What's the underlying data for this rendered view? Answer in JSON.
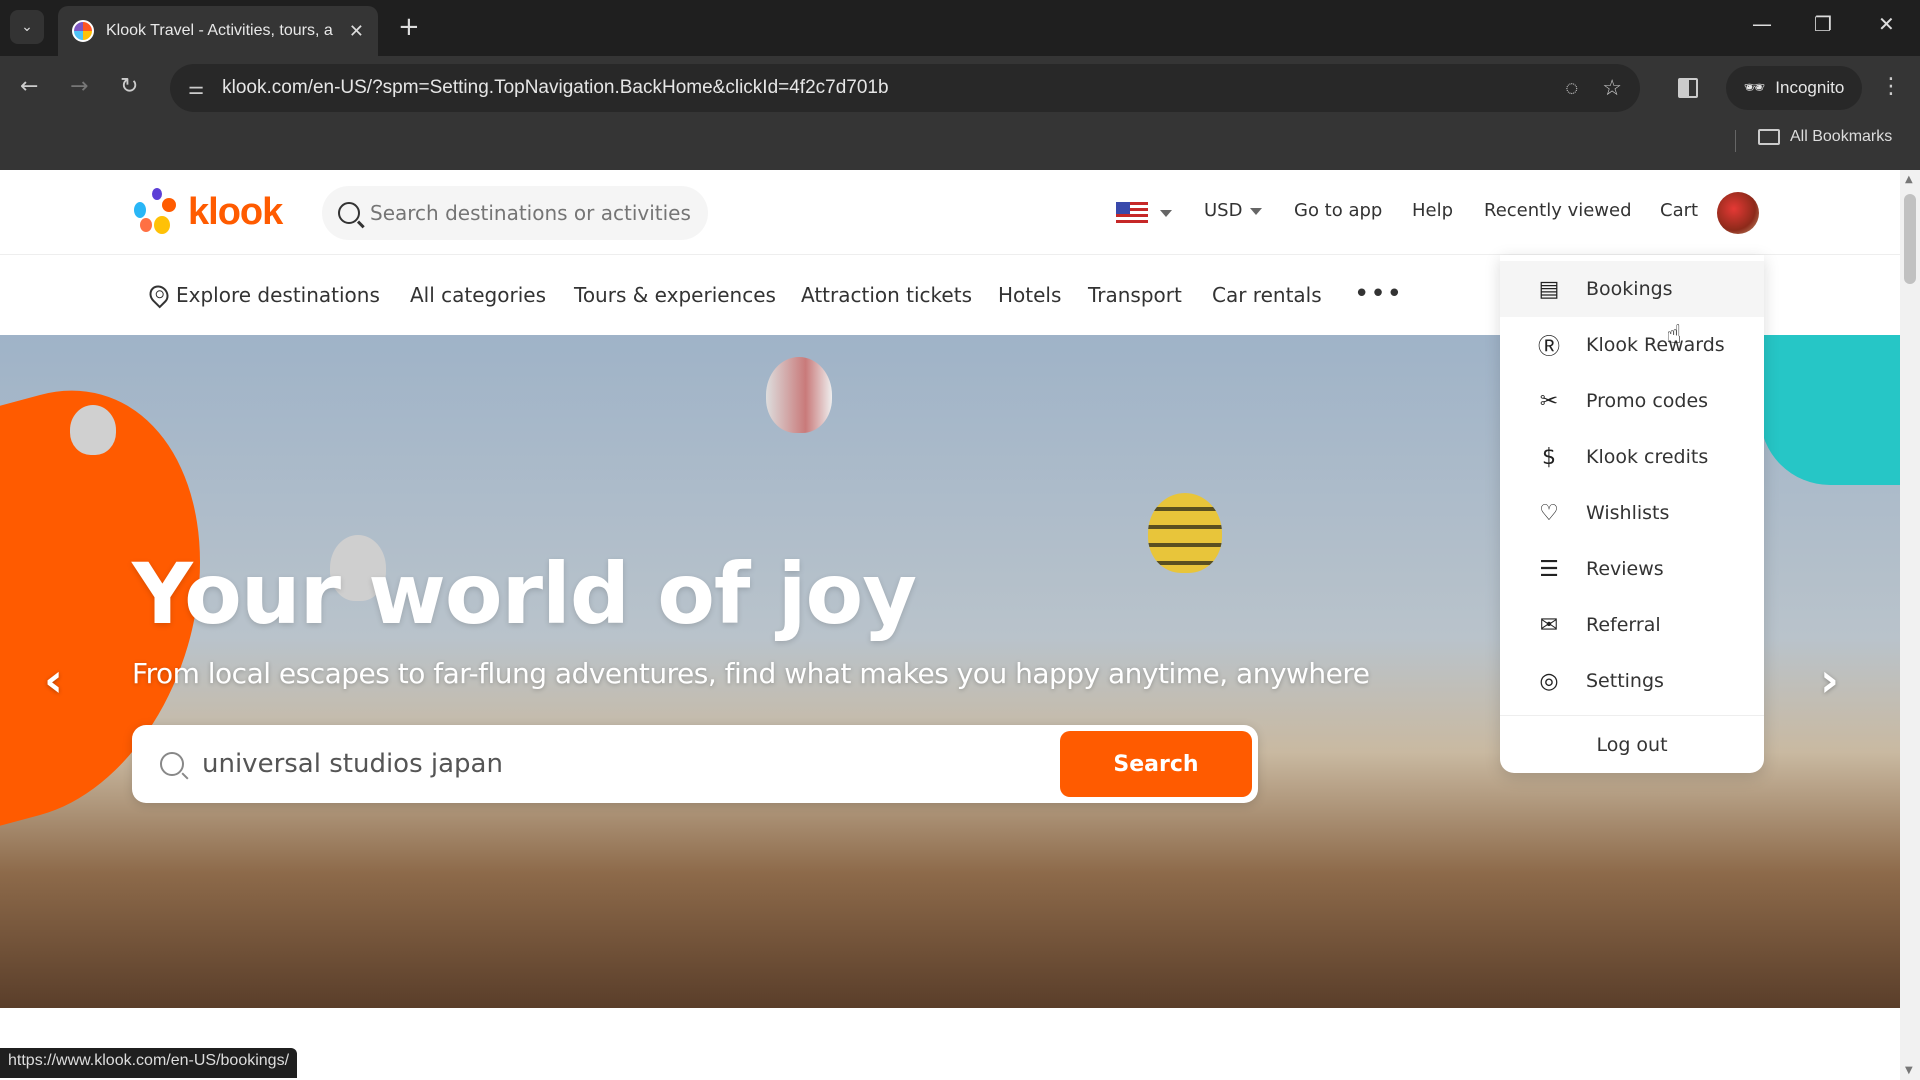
{
  "browser": {
    "tab_title": "Klook Travel - Activities, tours, a",
    "url": "klook.com/en-US/?spm=Setting.TopNavigation.BackHome&clickId=4f2c7d701b",
    "incognito_label": "Incognito",
    "all_bookmarks_label": "All Bookmarks",
    "status_url": "https://www.klook.com/en-US/bookings/"
  },
  "header": {
    "logo_text": "klook",
    "search_placeholder": "Search destinations or activities",
    "currency": "USD",
    "go_to_app": "Go to app",
    "help": "Help",
    "recently_viewed": "Recently viewed",
    "cart": "Cart"
  },
  "nav": {
    "items": [
      {
        "label": "Explore destinations",
        "icon": "location-pin-icon"
      },
      {
        "label": "All categories"
      },
      {
        "label": "Tours & experiences"
      },
      {
        "label": "Attraction tickets"
      },
      {
        "label": "Hotels"
      },
      {
        "label": "Transport"
      },
      {
        "label": "Car rentals"
      }
    ],
    "more_label": "•••"
  },
  "hero": {
    "title": "Your world of joy",
    "subtitle": "From local escapes to far-flung adventures, find what makes you happy anytime, anywhere",
    "search_value": "universal studios japan",
    "search_button": "Search",
    "prev_icon": "‹",
    "next_icon": "›"
  },
  "account_menu": {
    "items": [
      {
        "label": "Bookings",
        "icon": "bookings-icon",
        "glyph": "▤"
      },
      {
        "label": "Klook Rewards",
        "icon": "rewards-icon",
        "glyph": "Ⓡ"
      },
      {
        "label": "Promo codes",
        "icon": "promo-ticket-icon",
        "glyph": "✂"
      },
      {
        "label": "Klook credits",
        "icon": "money-bag-icon",
        "glyph": "$"
      },
      {
        "label": "Wishlists",
        "icon": "heart-icon",
        "glyph": "♡"
      },
      {
        "label": "Reviews",
        "icon": "review-bubble-icon",
        "glyph": "☰"
      },
      {
        "label": "Referral",
        "icon": "referral-envelope-icon",
        "glyph": "✉"
      },
      {
        "label": "Settings",
        "icon": "settings-icon",
        "glyph": "◎"
      }
    ],
    "logout_label": "Log out"
  },
  "colors": {
    "brand": "#ff5b00"
  }
}
